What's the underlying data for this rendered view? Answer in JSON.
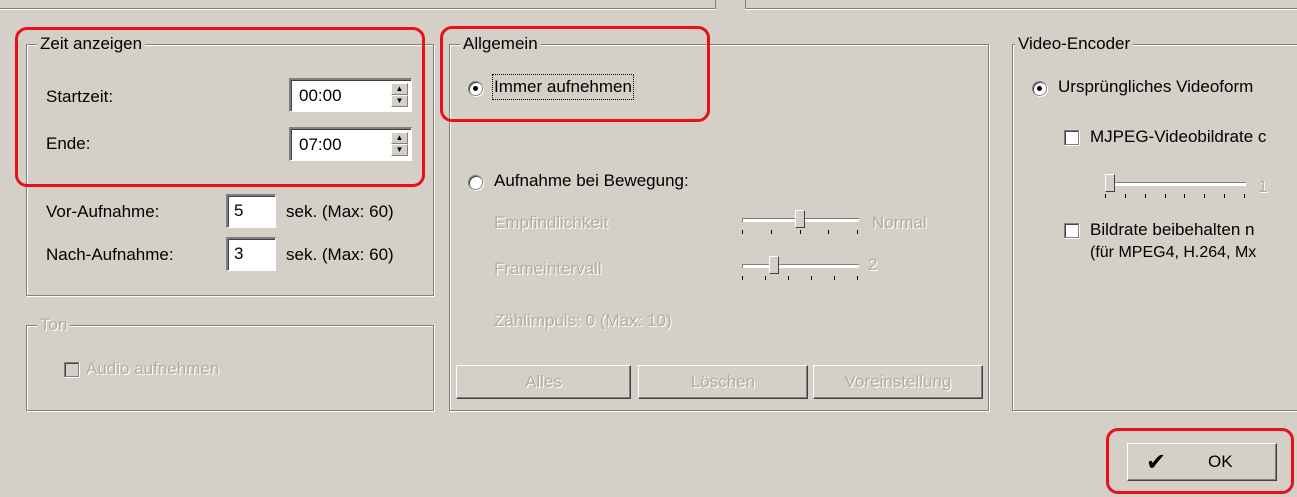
{
  "time_group": {
    "title": "Zeit anzeigen",
    "start_label": "Startzeit:",
    "start_value": "00:00",
    "end_label": "Ende:",
    "end_value": "07:00"
  },
  "pre_record": {
    "label": "Vor-Aufnahme:",
    "value": "5",
    "suffix": "sek. (Max: 60)"
  },
  "post_record": {
    "label": "Nach-Aufnahme:",
    "value": "3",
    "suffix": "sek. (Max: 60)"
  },
  "sound_group": {
    "title": "Ton",
    "audio_label": "Audio aufnehmen"
  },
  "general_group": {
    "title": "Allgemein",
    "always_label": "Immer aufnehmen",
    "motion_label": "Aufnahme bei Bewegung:",
    "sensitivity_label": "Empfindlichkeit",
    "sensitivity_value": "Normal",
    "sensitivity_level": 0.5,
    "frame_label": "Frameintervall",
    "frame_value": "2",
    "frame_level": 0.25,
    "pulse_label": "Zählimpuls: 0 (Max: 10)",
    "btn_all": "Alles",
    "btn_delete": "Löschen",
    "btn_preset": "Voreinstellung"
  },
  "encoder_group": {
    "title": "Video-Encoder",
    "original_label": "Ursprüngliches Videoform",
    "mjpeg_label": "MJPEG-Videobildrate c",
    "mjpeg_value": "1",
    "keep_label": "Bildrate beibehalten n",
    "keep_sub": "(für MPEG4, H.264, Mx"
  },
  "ok_button": "OK",
  "colors": {
    "highlight": "#e8101c",
    "window": "#d4d0c8"
  }
}
